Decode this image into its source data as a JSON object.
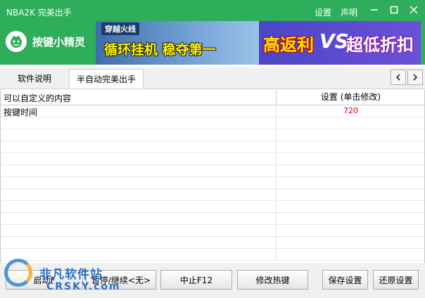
{
  "window": {
    "title": "NBA2K 完美出手",
    "settings_label": "设置",
    "declaration_label": "声明"
  },
  "brand": {
    "name": "按键小精灵"
  },
  "banner": {
    "game_tag": "穿越火线",
    "left_slogan": "循环挂机 稳夺第一",
    "right_text_1": "高返利",
    "vs": "VS",
    "right_text_2": "超低折扣"
  },
  "tabs": [
    {
      "label": "软件说明",
      "active": false
    },
    {
      "label": "半自动完美出手",
      "active": true
    }
  ],
  "grid": {
    "columns": [
      "可以自定义的内容",
      "设置 (单击修改)"
    ],
    "rows": [
      {
        "name": "按键时间",
        "value": "720"
      }
    ]
  },
  "footer": {
    "buttons": [
      "启动F",
      "暂停/继续<无>",
      "中止F12",
      "修改热键",
      "保存设置",
      "还原设置"
    ]
  },
  "watermark": {
    "text_cn": "非凡软件站",
    "text_en": "CRSKY.com"
  },
  "colors": {
    "accent": "#2eae5a",
    "value_red": "#e00000"
  }
}
